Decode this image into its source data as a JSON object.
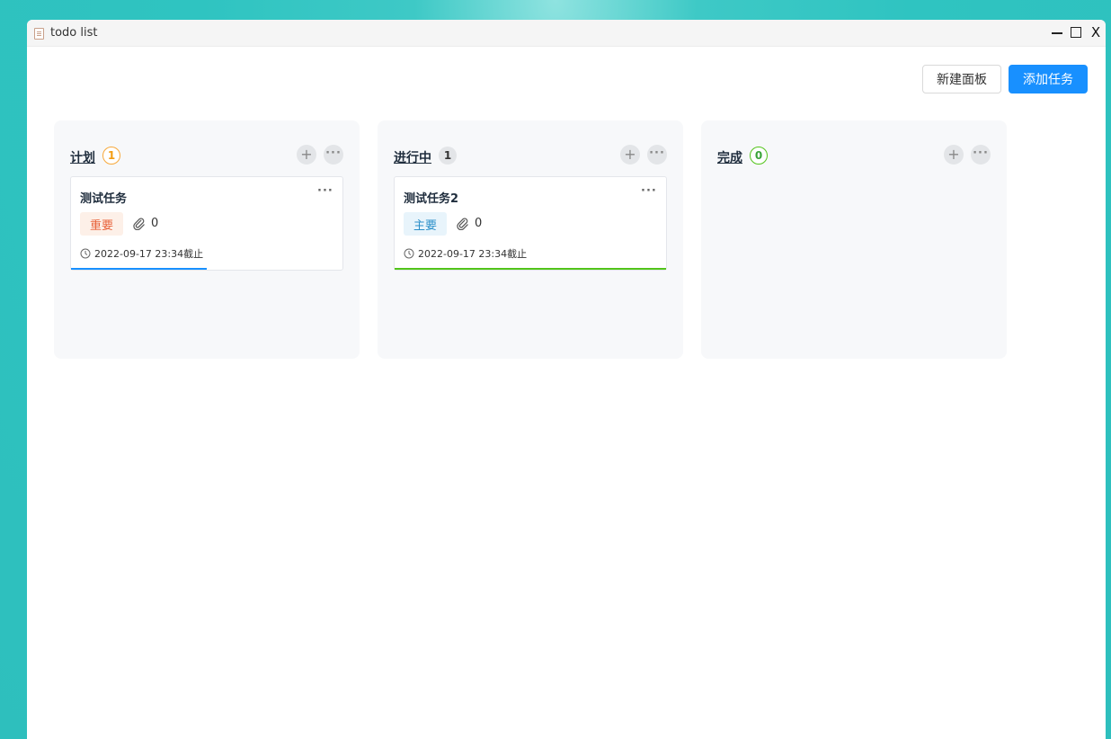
{
  "window": {
    "title": "todo list",
    "close_glyph": "X"
  },
  "toolbar": {
    "new_board_label": "新建面板",
    "add_task_label": "添加任务"
  },
  "columns": [
    {
      "title": "计划",
      "count": "1",
      "count_color": "#f39c12",
      "card": {
        "title": "测试任务",
        "tag": "重要",
        "attachments": "0",
        "deadline": "2022-09-17 23:34截止",
        "progress": 0.5,
        "progress_color": "#1890ff"
      }
    },
    {
      "title": "进行中",
      "count": "1",
      "count_color": "#333333",
      "card": {
        "title": "测试任务2",
        "tag": "主要",
        "attachments": "0",
        "deadline": "2022-09-17 23:34截止",
        "progress": 1.0,
        "progress_color": "#52c41a"
      }
    },
    {
      "title": "完成",
      "count": "0",
      "count_color": "#3aa33a"
    }
  ],
  "icons": {
    "add": "+",
    "more": "···",
    "attachment": "paperclip-icon",
    "clock": "clock-icon"
  }
}
